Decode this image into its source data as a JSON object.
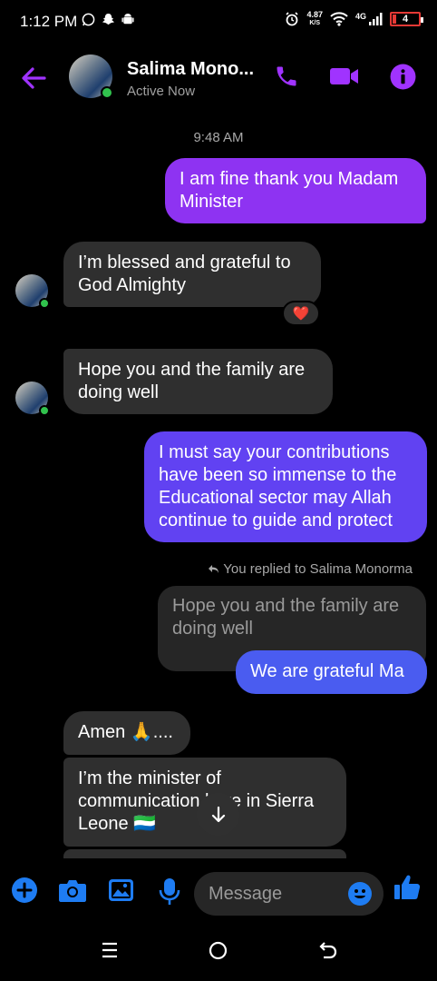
{
  "status_bar": {
    "time": "1:12 PM",
    "speed_value": "4.87",
    "speed_unit": "K/S",
    "network": "4G",
    "battery": "4"
  },
  "header": {
    "contact_name": "Salima Mono...",
    "status": "Active Now",
    "accent_color": "#a033ff"
  },
  "chat": {
    "timestamp": "9:48 AM",
    "messages": [
      {
        "from": "me",
        "text": "I am fine thank you Madam Minister"
      },
      {
        "from": "them",
        "text": "I’m blessed and grateful to God Almighty",
        "reaction": "❤️"
      },
      {
        "from": "them",
        "text": "Hope you and the family are doing well"
      },
      {
        "from": "me",
        "text": "I must say your contributions have been so immense to the Educational sector may Allah continue to guide and protect"
      },
      {
        "from": "me",
        "reply_label": "You replied to Salima Monorma",
        "quoted": "Hope you and the family are doing well",
        "text": "We are grateful Ma"
      },
      {
        "from": "them",
        "text": "Amen 🙏...."
      },
      {
        "from": "them",
        "text": "I’m the minister of communication here in Sierra Leone 🇸🇱"
      }
    ]
  },
  "composer": {
    "placeholder": "Message"
  },
  "colors": {
    "bubble_purple": "#8e33f2",
    "bubble_blue": "#4a5cf0",
    "bubble_gray": "#2f2f2f",
    "icon_blue": "#1e7cf2"
  }
}
